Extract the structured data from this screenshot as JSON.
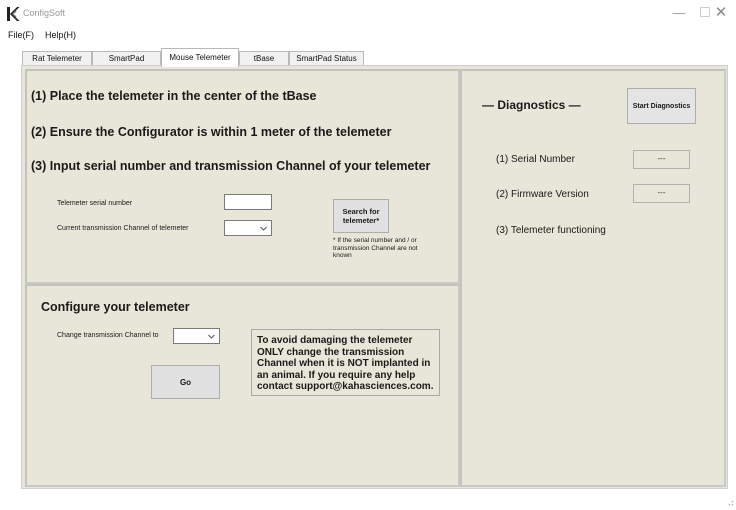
{
  "window": {
    "title": "ConfigSoft",
    "controls": {
      "minimize": "—",
      "close": "✕"
    }
  },
  "menu": [
    {
      "label": "File(F)"
    },
    {
      "label": "Help(H)"
    }
  ],
  "tabs": [
    {
      "label": "Rat Telemeter"
    },
    {
      "label": "SmartPad"
    },
    {
      "label": "Mouse Telemeter",
      "active": true
    },
    {
      "label": "tBase"
    },
    {
      "label": "SmartPad Status"
    }
  ],
  "instructions": {
    "step1": "(1) Place the telemeter in the center of the tBase",
    "step2": "(2) Ensure the Configurator is within 1 meter of the telemeter",
    "step3": "(3) Input serial number and transmission Channel of your telemeter",
    "serial_label": "Telemeter serial number",
    "serial_value": "",
    "channel_label": "Current transmission Channel of telemeter",
    "channel_value": "",
    "search_button": "Search for telemeter*",
    "search_note": "* If the serial number and / or transmission Channel are not known"
  },
  "configure": {
    "heading": "Configure your telemeter",
    "change_label": "Change transmission Channel to",
    "change_value": "",
    "go_button": "Go",
    "warning": "To avoid damaging the telemeter ONLY change the transmission Channel when it is NOT implanted in an animal.  If you require any help contact support@kahasciences.com."
  },
  "diagnostics": {
    "heading": "— Diagnostics —",
    "start_button": "Start Diagnostics",
    "items": [
      {
        "label": "(1) Serial Number",
        "value": "---"
      },
      {
        "label": "(2) Firmware Version",
        "value": "---"
      },
      {
        "label": "(3) Telemeter functioning"
      }
    ]
  },
  "icons": {
    "app_logo": "k-logo-icon",
    "dropdown": "chevron-down-icon",
    "resize": "resize-grip-icon"
  },
  "colors": {
    "panel_background": "#e7e6d8",
    "button_face": "#e1e1e1"
  }
}
